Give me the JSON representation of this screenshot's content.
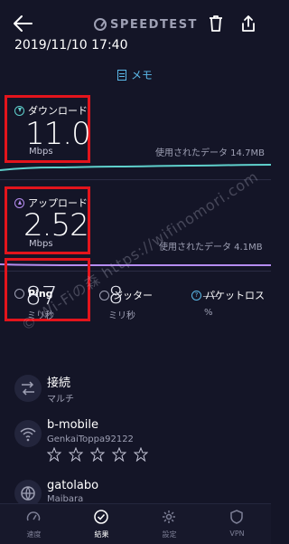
{
  "header": {
    "logo_text": "SPEEDTEST",
    "datetime": "2019/11/10 17:40",
    "memo_label": "メモ"
  },
  "download": {
    "label": "ダウンロード",
    "value": "11.0",
    "unit": "Mbps",
    "data_used": "使用されたデータ 14.7MB"
  },
  "upload": {
    "label": "アップロード",
    "value": "2.52",
    "unit": "Mbps",
    "data_used": "使用されたデータ 4.1MB"
  },
  "ping": {
    "label": "Ping",
    "value": "87",
    "unit": "ミリ秒"
  },
  "jitter": {
    "label": "ジッター",
    "value": "8",
    "unit": "ミリ秒"
  },
  "packet_loss": {
    "label": "パケットロス",
    "value": "—",
    "unit": "%"
  },
  "connection": {
    "title": "接続",
    "sub": "マルチ"
  },
  "provider": {
    "title": "b-mobile",
    "sub": "GenkaiToppa92122",
    "rating": 0,
    "max_rating": 5
  },
  "server": {
    "title": "gatolabo",
    "sub": "Maibara"
  },
  "watermark": {
    "text": "© Wi-Fiの森 https://wifinomori.com"
  },
  "tabs": [
    {
      "label": "速度",
      "icon": "speedometer-icon"
    },
    {
      "label": "結果",
      "icon": "check-circle-icon",
      "active": true
    },
    {
      "label": "設定",
      "icon": "gear-icon"
    },
    {
      "label": "VPN",
      "icon": "shield-icon"
    }
  ],
  "colors": {
    "background": "#141527",
    "download": "#5fd0cc",
    "upload": "#b58cf0",
    "highlight": "#e3141c",
    "accent": "#5bb8e8"
  }
}
